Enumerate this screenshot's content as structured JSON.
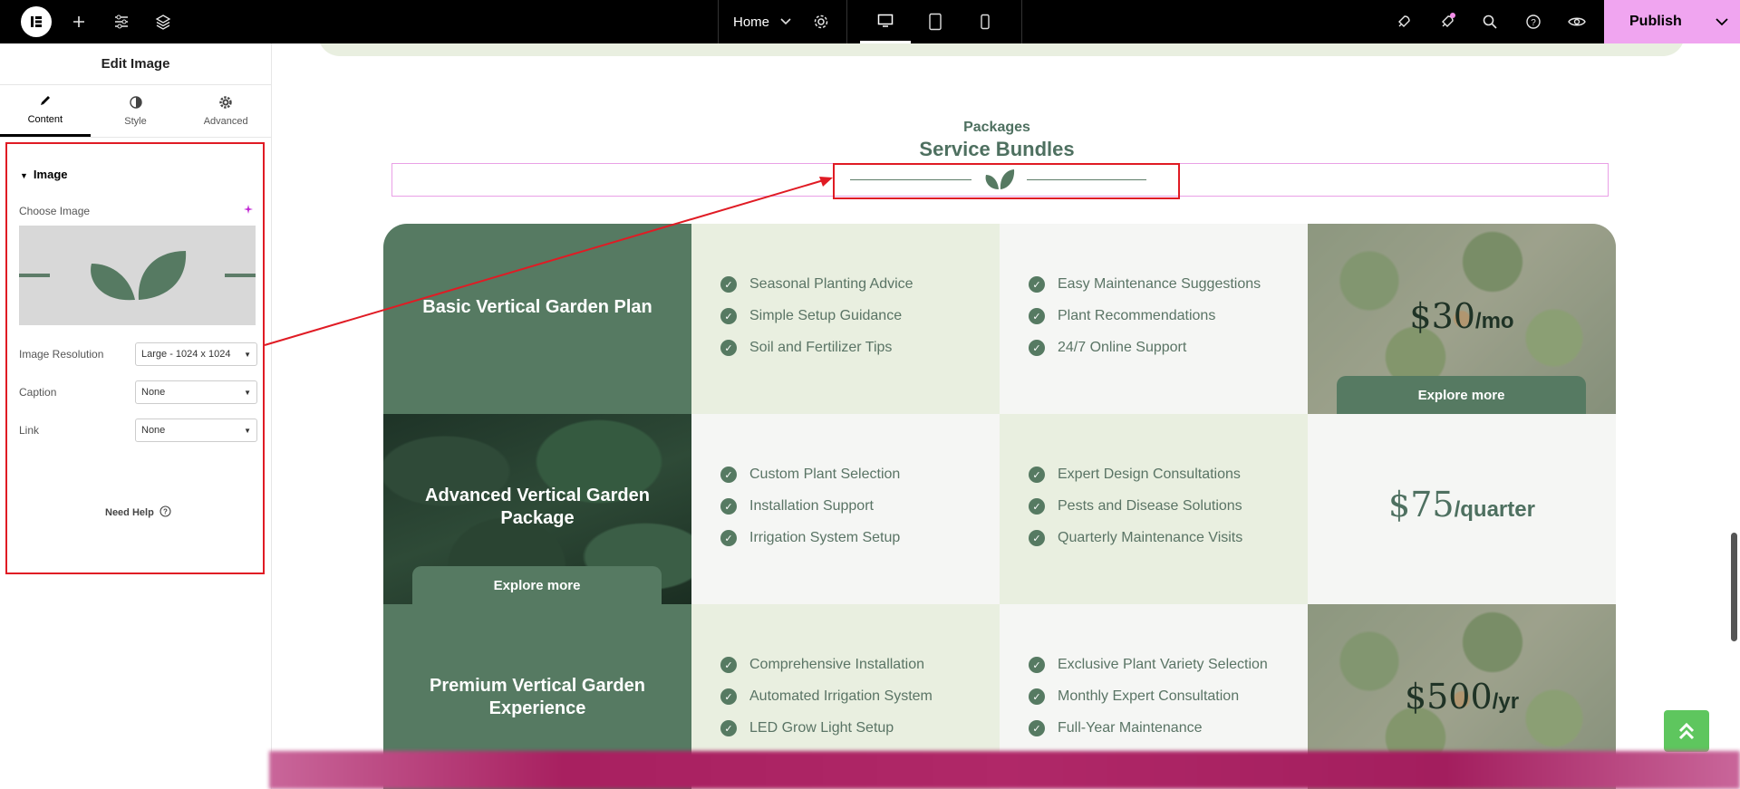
{
  "topbar": {
    "page_selector": "Home",
    "publish_label": "Publish"
  },
  "panel": {
    "title": "Edit Image",
    "tabs": [
      {
        "label": "Content",
        "icon": "pencil-icon"
      },
      {
        "label": "Style",
        "icon": "contrast-icon"
      },
      {
        "label": "Advanced",
        "icon": "gear-icon"
      }
    ],
    "section_title": "Image",
    "choose_image_label": "Choose Image",
    "resolution_label": "Image Resolution",
    "resolution_value": "Large - 1024 x 1024",
    "caption_label": "Caption",
    "caption_value": "None",
    "link_label": "Link",
    "link_value": "None",
    "need_help": "Need Help"
  },
  "section": {
    "eyebrow": "Packages",
    "title": "Service Bundles"
  },
  "plans": [
    {
      "name": "Basic Vertical Garden Plan",
      "features_a": [
        "Seasonal Planting Advice",
        "Simple Setup Guidance",
        "Soil and Fertilizer Tips"
      ],
      "features_b": [
        "Easy Maintenance Suggestions",
        "Plant Recommendations",
        "24/7 Online Support"
      ],
      "price": "$30",
      "period": "/mo",
      "cta": "Explore more"
    },
    {
      "name": "Advanced Vertical Garden Package",
      "features_a": [
        "Custom Plant Selection",
        "Installation Support",
        "Irrigation System Setup"
      ],
      "features_b": [
        "Expert Design Consultations",
        "Pests and Disease Solutions",
        "Quarterly Maintenance Visits"
      ],
      "price": "$75",
      "period": "/quarter",
      "cta": "Explore more"
    },
    {
      "name": "Premium Vertical Garden Experience",
      "features_a": [
        "Comprehensive Installation",
        "Automated Irrigation System",
        "LED Grow Light Setup"
      ],
      "features_b": [
        "Exclusive Plant Variety Selection",
        "Monthly Expert Consultation",
        "Full-Year Maintenance"
      ],
      "price": "$500",
      "period": "/yr"
    }
  ],
  "colors": {
    "brand_green": "#567a62",
    "light_green": "#e9efe0",
    "publish_pink": "#f0a5f0",
    "highlight_red": "#e01b24"
  }
}
